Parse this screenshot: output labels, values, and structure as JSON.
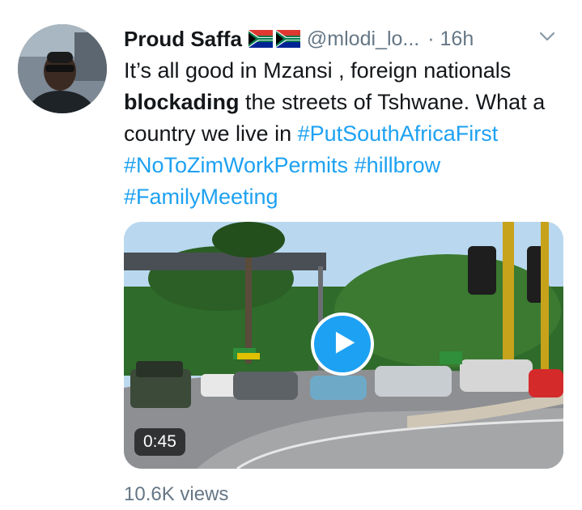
{
  "tweet": {
    "display_name": "Proud Saffa",
    "handle": "@mlodi_lo...",
    "time": "· 16h",
    "flag_icons": [
      "south-africa-flag-icon",
      "south-africa-flag-icon"
    ],
    "text": {
      "part1": "It’s all good in Mzansi , foreign nationals ",
      "bold": "blockading",
      "part2": " the streets of Tshwane. What a country we live in ",
      "hashtags": [
        "#PutSouthAfricaFirst",
        "#NoToZimWorkPermits",
        "#hillbrow",
        "#FamilyMeeting"
      ]
    },
    "video": {
      "duration": "0:45",
      "play_icon": "play-icon"
    },
    "views": "10.6K views",
    "colors": {
      "link": "#1da1f2",
      "secondary": "#657786",
      "primary_text": "#14171a"
    }
  }
}
